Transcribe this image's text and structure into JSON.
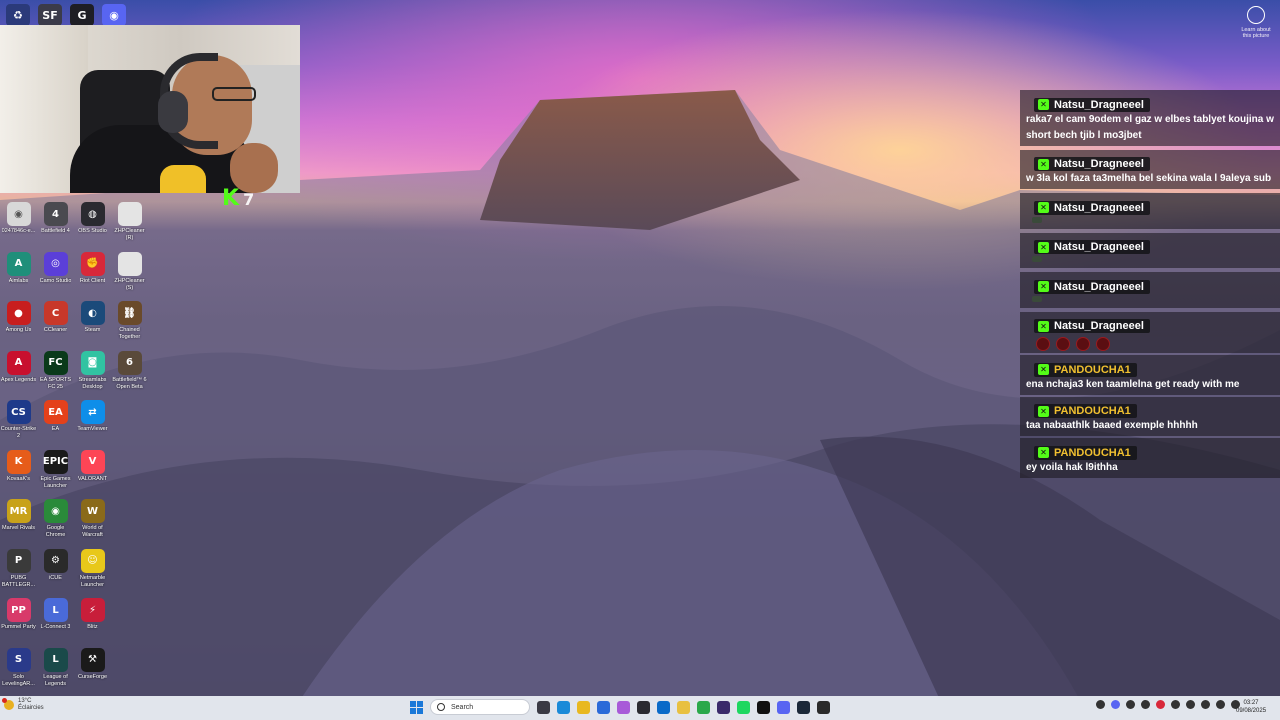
{
  "top_icons": [
    {
      "name": "recycle-bin-icon",
      "glyph": "♻",
      "color": "#2b3a7a"
    },
    {
      "name": "sf-app-icon",
      "glyph": "SF",
      "color": "#3b3b4a"
    },
    {
      "name": "g-hub-icon",
      "glyph": "G",
      "color": "#1e1e24"
    },
    {
      "name": "discord-icon",
      "glyph": "◉",
      "color": "#5865f2"
    }
  ],
  "stream": {
    "k_glyph": "K",
    "k_count": "7"
  },
  "desktop_icons": [
    {
      "label": "0247846c-e...",
      "icon": "chrome-file-icon",
      "glyph": "◉",
      "color": "#d8d8d8"
    },
    {
      "label": "Battlefield 4",
      "icon": "battlefield-icon",
      "glyph": "4",
      "color": "#4a4a50"
    },
    {
      "label": "OBS Studio",
      "icon": "obs-icon",
      "glyph": "◍",
      "color": "#2a2a30"
    },
    {
      "label": "ZHPCleaner (R)",
      "icon": "document-icon",
      "glyph": "",
      "color": "#e4e4e4"
    },
    {
      "label": "Aimlabs",
      "icon": "aimlabs-icon",
      "glyph": "A",
      "color": "#1f8f7a"
    },
    {
      "label": "Camo Studio",
      "icon": "camo-icon",
      "glyph": "◎",
      "color": "#5b3fd8"
    },
    {
      "label": "Riot Client",
      "icon": "riot-icon",
      "glyph": "✊",
      "color": "#d8283a"
    },
    {
      "label": "ZHPCleaner (S)",
      "icon": "document-icon",
      "glyph": "",
      "color": "#e4e4e4"
    },
    {
      "label": "Among Us",
      "icon": "among-us-icon",
      "glyph": "●",
      "color": "#c81e1e"
    },
    {
      "label": "CCleaner",
      "icon": "ccleaner-icon",
      "glyph": "C",
      "color": "#c8382a"
    },
    {
      "label": "Steam",
      "icon": "steam-icon",
      "glyph": "◐",
      "color": "#1b4a7a"
    },
    {
      "label": "Chained Together",
      "icon": "chained-together-icon",
      "glyph": "⛓",
      "color": "#6a4a2a"
    },
    {
      "label": "Apex Legends",
      "icon": "apex-icon",
      "glyph": "A",
      "color": "#c8102e"
    },
    {
      "label": "EA SPORTS FC 25",
      "icon": "ea-fc-icon",
      "glyph": "FC",
      "color": "#0a3a1a"
    },
    {
      "label": "Streamlabs Desktop",
      "icon": "streamlabs-icon",
      "glyph": "◙",
      "color": "#31c3a2"
    },
    {
      "label": "Battlefield™ 6 Open Beta",
      "icon": "battlefield-6-icon",
      "glyph": "6",
      "color": "#5a4a3a"
    },
    {
      "label": "Counter-Strike 2",
      "icon": "cs2-icon",
      "glyph": "CS",
      "color": "#1e3a8a"
    },
    {
      "label": "EA",
      "icon": "ea-icon",
      "glyph": "EA",
      "color": "#e4411b"
    },
    {
      "label": "TeamViewer",
      "icon": "teamviewer-icon",
      "glyph": "⇄",
      "color": "#0e8ee9"
    },
    {
      "label": "",
      "icon": "empty-icon",
      "glyph": "",
      "color": "transparent"
    },
    {
      "label": "KovaaK's",
      "icon": "kovaaks-icon",
      "glyph": "K",
      "color": "#e65c1a"
    },
    {
      "label": "Epic Games Launcher",
      "icon": "epic-games-icon",
      "glyph": "EPIC",
      "color": "#1a1a1a"
    },
    {
      "label": "VALORANT",
      "icon": "valorant-icon",
      "glyph": "V",
      "color": "#fd4556"
    },
    {
      "label": "",
      "icon": "empty-icon",
      "glyph": "",
      "color": "transparent"
    },
    {
      "label": "Marvel Rivals",
      "icon": "marvel-rivals-icon",
      "glyph": "MR",
      "color": "#c8a21a"
    },
    {
      "label": "Google Chrome",
      "icon": "chrome-icon",
      "glyph": "◉",
      "color": "#2a8a3a"
    },
    {
      "label": "World of Warcraft",
      "icon": "wow-icon",
      "glyph": "W",
      "color": "#8a6a1a"
    },
    {
      "label": "",
      "icon": "empty-icon",
      "glyph": "",
      "color": "transparent"
    },
    {
      "label": "PUBG BATTLEGR...",
      "icon": "pubg-icon",
      "glyph": "P",
      "color": "#3a3a3a"
    },
    {
      "label": "iCUE",
      "icon": "icue-icon",
      "glyph": "⚙",
      "color": "#2a2a2a"
    },
    {
      "label": "Netmarble Launcher",
      "icon": "netmarble-icon",
      "glyph": "☺",
      "color": "#e8c81a"
    },
    {
      "label": "",
      "icon": "empty-icon",
      "glyph": "",
      "color": "transparent"
    },
    {
      "label": "Pummel Party",
      "icon": "pummel-party-icon",
      "glyph": "PP",
      "color": "#d83a6a"
    },
    {
      "label": "L-Connect 3",
      "icon": "l-connect-icon",
      "glyph": "L",
      "color": "#4a6ad8"
    },
    {
      "label": "Blitz",
      "icon": "blitz-icon",
      "glyph": "⚡",
      "color": "#c81e3a"
    },
    {
      "label": "",
      "icon": "empty-icon",
      "glyph": "",
      "color": "transparent"
    },
    {
      "label": "Solo LevelingAR...",
      "icon": "solo-leveling-icon",
      "glyph": "S",
      "color": "#2a3a8a"
    },
    {
      "label": "League of Legends",
      "icon": "league-icon",
      "glyph": "L",
      "color": "#1a4a4a"
    },
    {
      "label": "CurseForge",
      "icon": "curseforge-icon",
      "glyph": "⚒",
      "color": "#1a1a1a"
    },
    {
      "label": "",
      "icon": "empty-icon",
      "glyph": "",
      "color": "transparent"
    }
  ],
  "learn": {
    "label": "Learn about this picture"
  },
  "chat": {
    "messages": [
      {
        "user": "Natsu_Dragneeel",
        "user_color": "#ffffff",
        "text": "raka7 el cam 9odem el gaz w elbes tablyet koujina w short bech tjib l mo3jbet",
        "kind": "text"
      },
      {
        "user": "Natsu_Dragneeel",
        "user_color": "#ffffff",
        "text": "w 3la kol faza ta3melha bel sekina wala l 9aleya sub",
        "kind": "text"
      },
      {
        "user": "Natsu_Dragneeel",
        "user_color": "#ffffff",
        "text": "",
        "kind": "emote-small"
      },
      {
        "user": "Natsu_Dragneeel",
        "user_color": "#ffffff",
        "text": "",
        "kind": "emote-small"
      },
      {
        "user": "Natsu_Dragneeel",
        "user_color": "#ffffff",
        "text": "",
        "kind": "emote-small"
      },
      {
        "user": "Natsu_Dragneeel",
        "user_color": "#ffffff",
        "text": "",
        "kind": "emote-row"
      },
      {
        "user": "PANDOUCHA1",
        "user_color": "#f0c030",
        "text": "ena nchaja3 ken taamlelna get ready with me",
        "kind": "text"
      },
      {
        "user": "PANDOUCHA1",
        "user_color": "#f0c030",
        "text": "taa nabaathlk baaed exemple hhhhh",
        "kind": "text"
      },
      {
        "user": "PANDOUCHA1",
        "user_color": "#f0c030",
        "text": "ey voila hak l9ithha",
        "kind": "text"
      }
    ]
  },
  "taskbar": {
    "weather_temp": "13°C",
    "weather_desc": "Éclaircies",
    "search_placeholder": "Search",
    "apps": [
      {
        "name": "task-view-icon",
        "color": "#3a3a44"
      },
      {
        "name": "edge-icon",
        "color": "#1a8ad8"
      },
      {
        "name": "file-explorer-icon",
        "color": "#e8b820"
      },
      {
        "name": "store-icon",
        "color": "#2a6ad8"
      },
      {
        "name": "copilot-icon",
        "color": "#a85ad8"
      },
      {
        "name": "obs-icon",
        "color": "#2a2a30"
      },
      {
        "name": "outlook-icon",
        "color": "#0a6ac8"
      },
      {
        "name": "explorer-icon",
        "color": "#e8c040"
      },
      {
        "name": "chrome-icon",
        "color": "#2aa84a"
      },
      {
        "name": "netflix-icon",
        "color": "#3a2a6a"
      },
      {
        "name": "spotify-icon",
        "color": "#1ed760"
      },
      {
        "name": "capcut-icon",
        "color": "#111111"
      },
      {
        "name": "discord-icon",
        "color": "#5865f2"
      },
      {
        "name": "steam-icon",
        "color": "#1b2838"
      },
      {
        "name": "streamlabs-icon",
        "color": "#2a2a2a"
      }
    ],
    "tray": [
      {
        "name": "chevron-up-icon",
        "color": "#333333"
      },
      {
        "name": "discord-tray-icon",
        "color": "#5865f2"
      },
      {
        "name": "icue-tray-icon",
        "color": "#333333"
      },
      {
        "name": "steam-tray-icon",
        "color": "#333333"
      },
      {
        "name": "record-tray-icon",
        "color": "#d8283a"
      },
      {
        "name": "teams-tray-icon",
        "color": "#333333"
      },
      {
        "name": "microphone-icon",
        "color": "#333333"
      },
      {
        "name": "network-icon",
        "color": "#333333"
      },
      {
        "name": "volume-icon",
        "color": "#333333"
      },
      {
        "name": "battery-icon",
        "color": "#333333"
      }
    ],
    "time": "03:27",
    "date": "09/08/2025"
  }
}
